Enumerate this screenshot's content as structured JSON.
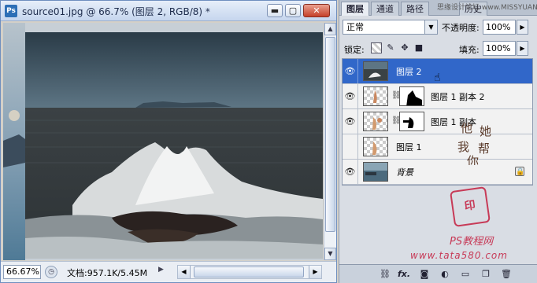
{
  "document": {
    "title": "source01.jpg @ 66.7% (图层 2, RGB/8) *",
    "app_icon": "Ps",
    "window_buttons": {
      "minimize": "▬",
      "maximize": "▢",
      "close": "✕"
    },
    "zoom": "66.67%",
    "doc_info": "文档:957.1K/5.45M"
  },
  "panel": {
    "tabs": [
      "图层",
      "通道",
      "路径",
      "历史"
    ],
    "top_watermark": "思缘设计论坛 www.MISSYUAN.COM",
    "blend_mode": "正常",
    "opacity_label": "不透明度:",
    "opacity_value": "100%",
    "lock_label": "锁定:",
    "fill_label": "填充:",
    "fill_value": "100%",
    "layers": [
      {
        "name": "图层 2",
        "visible": true,
        "selected": true
      },
      {
        "name": "图层 1 副本 2",
        "visible": true,
        "selected": false
      },
      {
        "name": "图层 1 副本",
        "visible": true,
        "selected": false
      },
      {
        "name": "图层 1",
        "visible": false,
        "selected": false
      },
      {
        "name": "背景",
        "visible": true,
        "selected": false
      }
    ],
    "bottom_icons": [
      "link-icon",
      "fx-icon",
      "mask-icon",
      "adjustment-icon",
      "folder-icon",
      "new-layer-icon",
      "trash-icon"
    ],
    "bottom_fx_label": "fx."
  },
  "watermark": {
    "calligraphy": "他她我帮你",
    "seal": "朱印",
    "ps_label": "PS教程网",
    "url": "www.tata580.com"
  },
  "colors": {
    "selection": "#3167c9",
    "watermark": "#c73a57"
  }
}
